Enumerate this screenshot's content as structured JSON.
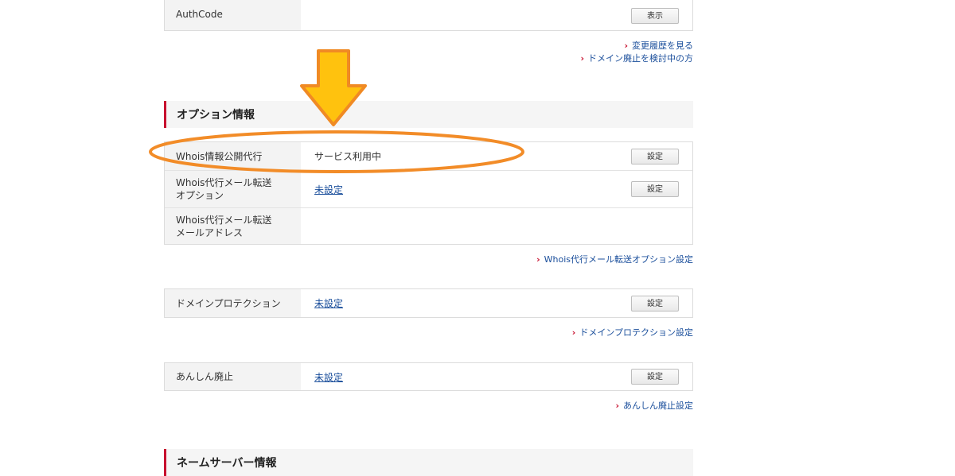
{
  "authcode": {
    "label": "AuthCode",
    "button": "表示"
  },
  "links_top": {
    "history": "変更履歴を見る",
    "abandon": "ドメイン廃止を検討中の方"
  },
  "option_section": {
    "title": "オプション情報"
  },
  "whois_table": {
    "rows": [
      {
        "label": [
          "Whois情報公開代行"
        ],
        "value": "サービス利用中",
        "button": "設定"
      },
      {
        "label": [
          "Whois代行メール転送",
          "オプション"
        ],
        "value": "未設定",
        "button": "設定"
      },
      {
        "label": [
          "Whois代行メール転送",
          "メールアドレス"
        ],
        "value": ""
      }
    ]
  },
  "whois_forward_link": "Whois代行メール転送オプション設定",
  "protection": {
    "label": "ドメインプロテクション",
    "value": "未設定",
    "button": "設定",
    "link": "ドメインプロテクション設定"
  },
  "anshin": {
    "label": "あんしん廃止",
    "value": "未設定",
    "button": "設定",
    "link": "あんしん廃止設定"
  },
  "nameserver_section": {
    "title": "ネームサーバー情報"
  },
  "annotation": {
    "arrow_color": "#f7b500",
    "ellipse_color": "#f28c28"
  }
}
